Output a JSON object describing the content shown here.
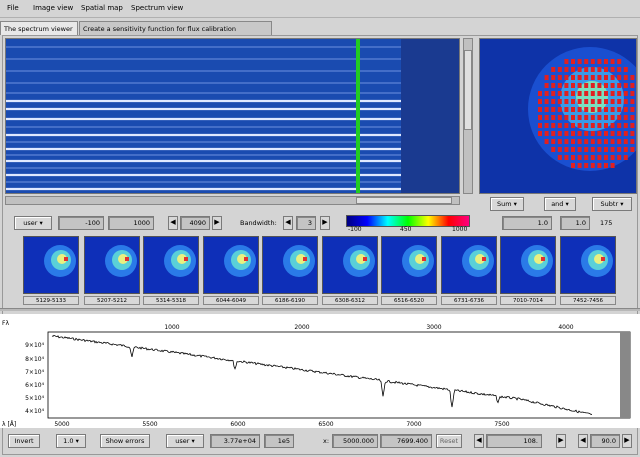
{
  "menubar": {
    "items": [
      "File",
      "Image view",
      "Spatial map",
      "Spectrum view"
    ]
  },
  "tabs": [
    "The spectrum viewer",
    "Create a sensitivity function for flux calibration"
  ],
  "map_controls": {
    "mode": "Sum",
    "logic": "and",
    "subtract": "Subtr",
    "field1": "1.0",
    "field2": "1.0",
    "count": "175"
  },
  "range_controls": {
    "scale_mode": "user",
    "min": "-100",
    "max": "1000",
    "channel": "4090",
    "bandwidth_label": "Bandwidth:",
    "bandwidth": "3"
  },
  "colorbar": {
    "ticks": [
      "-100",
      "450",
      "1000"
    ]
  },
  "thumbnails": [
    "5129-5133",
    "5207-5212",
    "5314-5318",
    "6044-6049",
    "6186-6190",
    "6308-6312",
    "6516-6520",
    "6731-6736",
    "7010-7014",
    "7452-7456"
  ],
  "spectrum": {
    "top_ticks": [
      "1000",
      "2000",
      "3000",
      "4000"
    ],
    "y_ticks": [
      "9×10⁴",
      "8×10⁴",
      "7×10⁴",
      "6×10⁴",
      "5×10⁴",
      "4×10⁴"
    ],
    "x_ticks": [
      "5000",
      "5500",
      "6000",
      "6500",
      "7000",
      "7500"
    ],
    "y_symbol": "Fλ",
    "x_symbol": "λ [Å]"
  },
  "bottombar": {
    "invert": "Invert",
    "scale": "1.0",
    "show_errors": "Show errors",
    "mode": "user",
    "ymin": "3.77e+04",
    "ymax": "1e5",
    "x_label": "x:",
    "xmin": "5000.000",
    "xmax": "7699.400",
    "reset": "Reset",
    "zoom": "108.",
    "percent": "90.0"
  }
}
